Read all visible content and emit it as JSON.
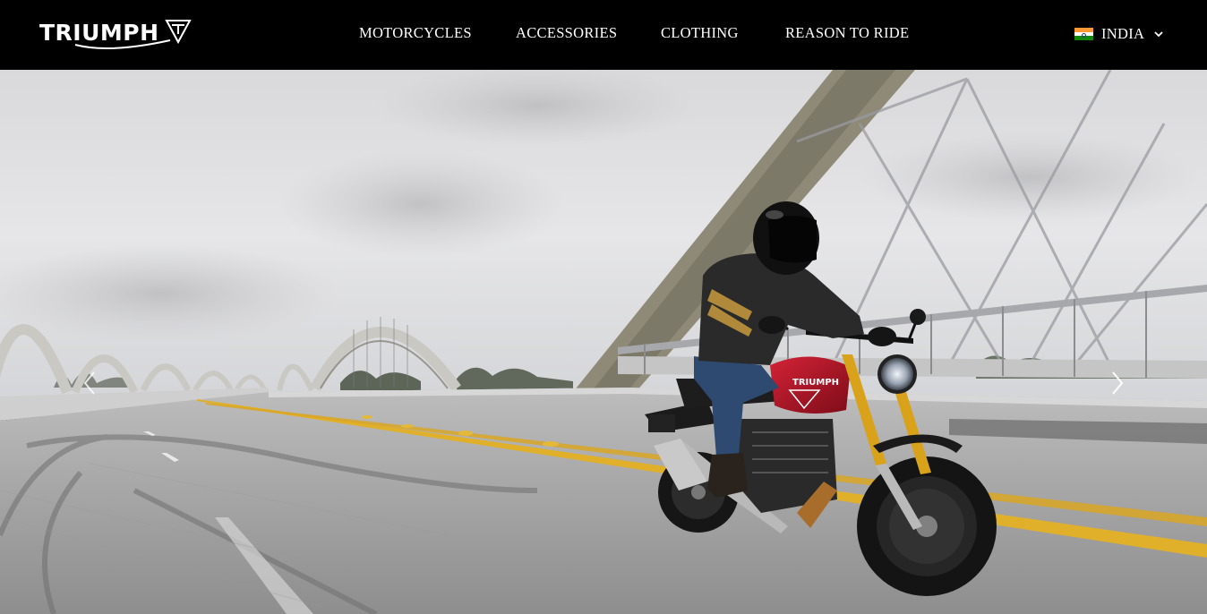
{
  "brand": {
    "logo_text": "TRIUMPH",
    "logo_icon": "triumph-t-badge-icon"
  },
  "nav": {
    "items": [
      {
        "label": "MOTORCYCLES"
      },
      {
        "label": "ACCESSORIES"
      },
      {
        "label": "CLOTHING"
      },
      {
        "label": "REASON TO RIDE"
      }
    ]
  },
  "region": {
    "label": "INDIA",
    "flag_icon": "india-flag-icon",
    "dropdown_icon": "chevron-down-icon",
    "flag_colors": [
      "#FF9933",
      "#FFFFFF",
      "#138808"
    ]
  },
  "hero": {
    "image": "motorcycle-rider-on-bridge-image",
    "prev_icon": "chevron-left-icon",
    "next_icon": "chevron-right-icon",
    "bike_badge_text": "TRIUMPH"
  },
  "colors": {
    "header_bg": "#000000",
    "nav_text": "#FFFFFF",
    "bike_tank": "#B01226",
    "fork_gold": "#D9A21B",
    "road_line": "#E3B52C"
  }
}
